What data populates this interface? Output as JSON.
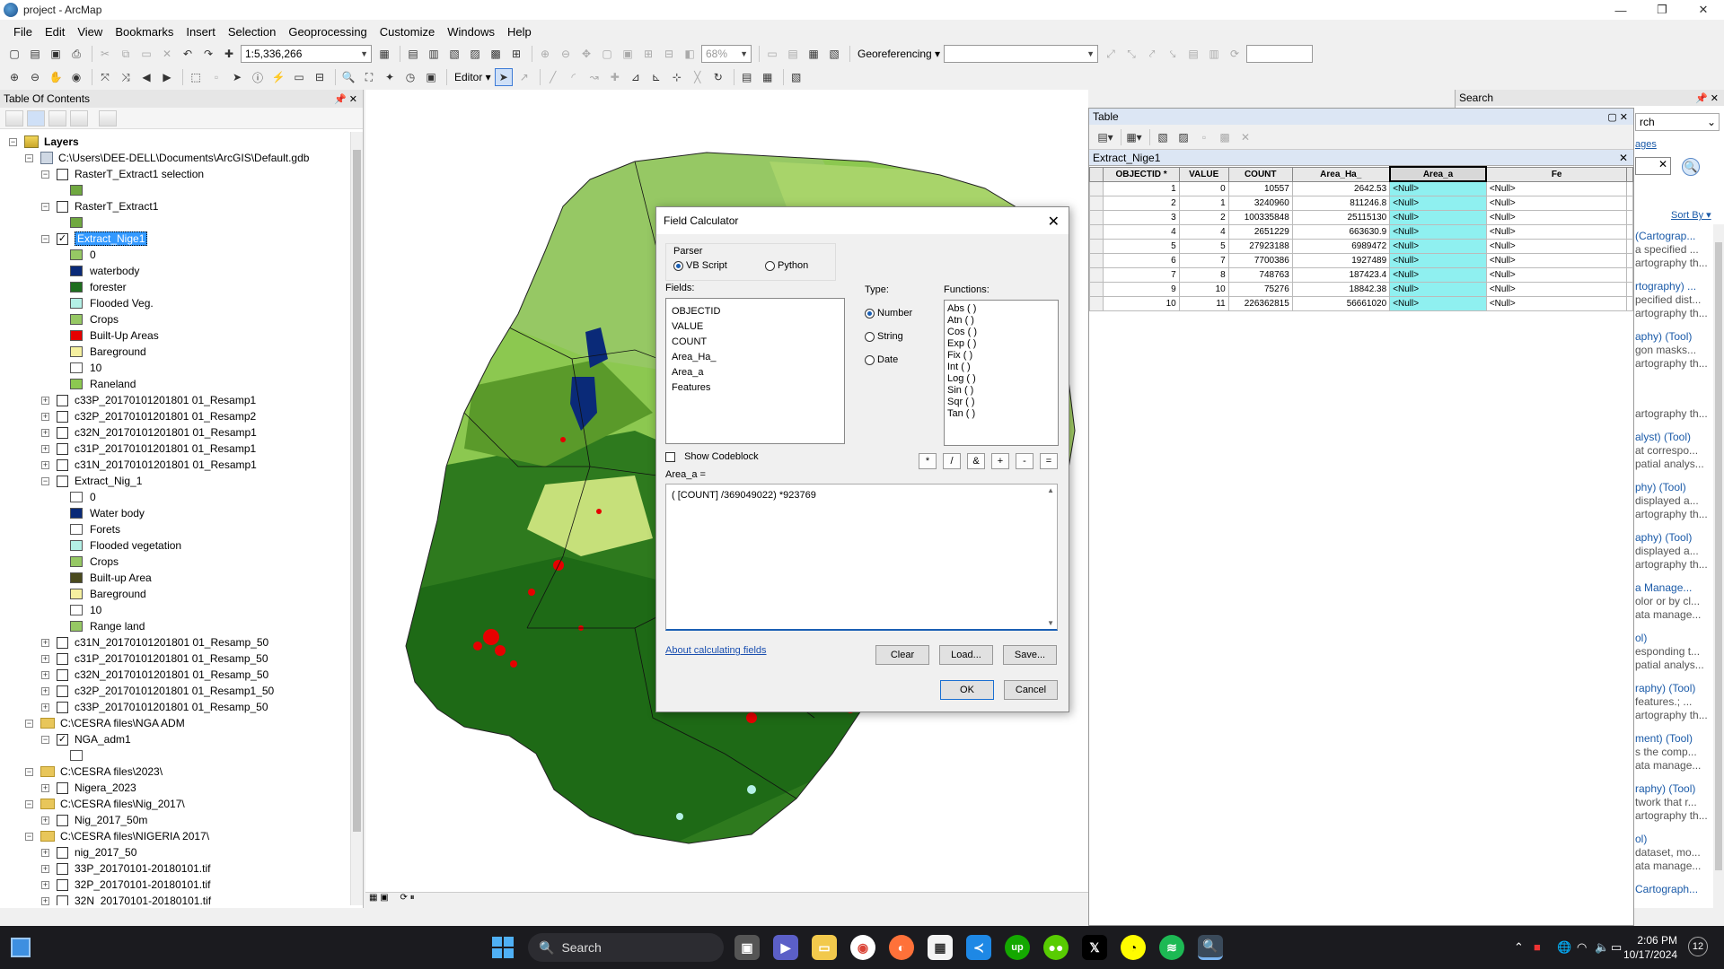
{
  "window": {
    "title": "project - ArcMap",
    "controls": [
      "—",
      "❐",
      "✕"
    ]
  },
  "menu": [
    "File",
    "Edit",
    "View",
    "Bookmarks",
    "Insert",
    "Selection",
    "Geoprocessing",
    "Customize",
    "Windows",
    "Help"
  ],
  "toolbar": {
    "scale": "1:5,336,266",
    "zoom_percent": "68%",
    "georef_label": "Georeferencing ▾",
    "editor_label": "Editor ▾"
  },
  "toc": {
    "title": "Table Of Contents",
    "items": [
      {
        "kind": "root",
        "label": "Layers"
      },
      {
        "kind": "db",
        "label": "C:\\Users\\DEE-DELL\\Documents\\ArcGIS\\Default.gdb"
      },
      {
        "kind": "layer",
        "label": "RasterT_Extract1 selection",
        "checked": false
      },
      {
        "kind": "swatch",
        "label": "",
        "color": "#70a840"
      },
      {
        "kind": "layer",
        "label": "RasterT_Extract1",
        "checked": false
      },
      {
        "kind": "swatch",
        "label": "",
        "color": "#70a840"
      },
      {
        "kind": "layer",
        "label": "Extract_Nige1",
        "checked": true,
        "selected": true
      },
      {
        "kind": "swatch",
        "label": "0",
        "color": "#96c864"
      },
      {
        "kind": "swatch",
        "label": "waterbody",
        "color": "#0a2a78"
      },
      {
        "kind": "swatch",
        "label": "forester",
        "color": "#1e6e1e"
      },
      {
        "kind": "swatch",
        "label": "Flooded Veg.",
        "color": "#b4f0e6"
      },
      {
        "kind": "swatch",
        "label": "Crops",
        "color": "#96c864"
      },
      {
        "kind": "swatch",
        "label": "Built-Up Areas",
        "color": "#e60000"
      },
      {
        "kind": "swatch",
        "label": "Bareground",
        "color": "#f5f0a0"
      },
      {
        "kind": "swatch",
        "label": "10",
        "color": "#ffffff"
      },
      {
        "kind": "swatch",
        "label": "Raneland",
        "color": "#8cc850"
      },
      {
        "kind": "layer",
        "label": "c33P_20170101201801 01_Resamp1",
        "checked": false,
        "collapsed": true
      },
      {
        "kind": "layer",
        "label": "c32P_20170101201801 01_Resamp2",
        "checked": false,
        "collapsed": true
      },
      {
        "kind": "layer",
        "label": "c32N_20170101201801 01_Resamp1",
        "checked": false,
        "collapsed": true
      },
      {
        "kind": "layer",
        "label": "c31P_20170101201801 01_Resamp1",
        "checked": false,
        "collapsed": true
      },
      {
        "kind": "layer",
        "label": "c31N_20170101201801 01_Resamp1",
        "checked": false,
        "collapsed": true
      },
      {
        "kind": "layer",
        "label": "Extract_Nig_1",
        "checked": false
      },
      {
        "kind": "swatch",
        "label": "0",
        "color": "#ffffff"
      },
      {
        "kind": "swatch",
        "label": "Water body",
        "color": "#0a2a78"
      },
      {
        "kind": "swatch",
        "label": "Forets",
        "color": "#ffffff"
      },
      {
        "kind": "swatch",
        "label": "Flooded vegetation",
        "color": "#b4f0e6"
      },
      {
        "kind": "swatch",
        "label": "Crops",
        "color": "#96c864"
      },
      {
        "kind": "swatch",
        "label": "Built-up Area",
        "color": "#4a4a1e"
      },
      {
        "kind": "swatch",
        "label": "Bareground",
        "color": "#f5f0a0"
      },
      {
        "kind": "swatch",
        "label": "10",
        "color": "#ffffff"
      },
      {
        "kind": "swatch",
        "label": "Range land",
        "color": "#96c864"
      },
      {
        "kind": "layer",
        "label": "c31N_20170101201801 01_Resamp_50",
        "checked": false,
        "collapsed": true
      },
      {
        "kind": "layer",
        "label": "c31P_20170101201801 01_Resamp_50",
        "checked": false,
        "collapsed": true
      },
      {
        "kind": "layer",
        "label": "c32N_20170101201801 01_Resamp_50",
        "checked": false,
        "collapsed": true
      },
      {
        "kind": "layer",
        "label": "c32P_20170101201801 01_Resamp1_50",
        "checked": false,
        "collapsed": true
      },
      {
        "kind": "layer",
        "label": "c33P_20170101201801 01_Resamp_50",
        "checked": false,
        "collapsed": true
      },
      {
        "kind": "folder",
        "label": "C:\\CESRA files\\NGA ADM"
      },
      {
        "kind": "layer",
        "label": "NGA_adm1",
        "checked": true
      },
      {
        "kind": "swatch",
        "label": "",
        "color": "#ffffff"
      },
      {
        "kind": "folder",
        "label": "C:\\CESRA files\\2023\\"
      },
      {
        "kind": "layer",
        "label": "Nigera_2023",
        "checked": false,
        "collapsed": true
      },
      {
        "kind": "folder",
        "label": "C:\\CESRA files\\Nig_2017\\"
      },
      {
        "kind": "layer",
        "label": "Nig_2017_50m",
        "checked": false,
        "collapsed": true
      },
      {
        "kind": "folder",
        "label": "C:\\CESRA files\\NIGERIA 2017\\"
      },
      {
        "kind": "layer",
        "label": "nig_2017_50",
        "checked": false,
        "collapsed": true
      },
      {
        "kind": "layer",
        "label": "33P_20170101-20180101.tif",
        "checked": false,
        "collapsed": true
      },
      {
        "kind": "layer",
        "label": "32P_20170101-20180101.tif",
        "checked": false,
        "collapsed": true
      },
      {
        "kind": "layer",
        "label": "32N_20170101-20180101.tif",
        "checked": false,
        "collapsed": true
      }
    ]
  },
  "field_calculator": {
    "title": "Field Calculator",
    "parser_label": "Parser",
    "parser_vb": "VB Script",
    "parser_python": "Python",
    "fields_label": "Fields:",
    "fields": [
      "OBJECTID",
      "VALUE",
      "COUNT",
      "Area_Ha_",
      "Area_a",
      "Features"
    ],
    "type_label": "Type:",
    "types": [
      "Number",
      "String",
      "Date"
    ],
    "functions_label": "Functions:",
    "functions": [
      "Abs ( )",
      "Atn ( )",
      "Cos ( )",
      "Exp ( )",
      "Fix ( )",
      "Int ( )",
      "Log ( )",
      "Sin ( )",
      "Sqr ( )",
      "Tan ( )"
    ],
    "show_codeblock": "Show Codeblock",
    "operators": [
      "*",
      "/",
      "&",
      "+",
      "-",
      "="
    ],
    "target_label": "Area_a =",
    "expression": "( [COUNT] /369049022) *923769",
    "help_link": "About calculating fields",
    "clear": "Clear",
    "load": "Load...",
    "save": "Save...",
    "ok": "OK",
    "cancel": "Cancel"
  },
  "table": {
    "window_title": "Table",
    "tab_title": "Extract_Nige1",
    "columns": [
      "OBJECTID *",
      "VALUE",
      "COUNT",
      "Area_Ha_",
      "Area_a",
      "Fe"
    ],
    "rows": [
      [
        "1",
        "0",
        "10557",
        "2642.53",
        "<Null>",
        "<Null>"
      ],
      [
        "2",
        "1",
        "3240960",
        "811246.8",
        "<Null>",
        "<Null>"
      ],
      [
        "3",
        "2",
        "100335848",
        "25115130",
        "<Null>",
        "<Null>"
      ],
      [
        "4",
        "4",
        "2651229",
        "663630.9",
        "<Null>",
        "<Null>"
      ],
      [
        "5",
        "5",
        "27923188",
        "6989472",
        "<Null>",
        "<Null>"
      ],
      [
        "6",
        "7",
        "7700386",
        "1927489",
        "<Null>",
        "<Null>"
      ],
      [
        "7",
        "8",
        "748763",
        "187423.4",
        "<Null>",
        "<Null>"
      ],
      [
        "9",
        "10",
        "75276",
        "18842.38",
        "<Null>",
        "<Null>"
      ],
      [
        "10",
        "11",
        "226362815",
        "56661020",
        "<Null>",
        "<Null>"
      ]
    ]
  },
  "search": {
    "title": "Search",
    "query_fragment": "rch",
    "link_fragment": "ages",
    "sort": "Sort By ▾",
    "results": [
      {
        "t": "(Cartograp...",
        "d1": "a specified ...",
        "d2": "artography th..."
      },
      {
        "t": "rtography) ...",
        "d1": "pecified dist...",
        "d2": "artography th..."
      },
      {
        "t": "aphy) (Tool)",
        "d1": "gon masks...",
        "d2": "artography th..."
      },
      {
        "t": "",
        "d1": "",
        "d2": "artography th..."
      },
      {
        "t": "alyst) (Tool)",
        "d1": "at correspo...",
        "d2": "patial analys..."
      },
      {
        "t": "phy) (Tool)",
        "d1": "displayed a...",
        "d2": "artography th..."
      },
      {
        "t": "aphy) (Tool)",
        "d1": "displayed a...",
        "d2": "artography th..."
      },
      {
        "t": "a Manage...",
        "d1": "olor or by cl...",
        "d2": "ata manage..."
      },
      {
        "t": "ol)",
        "d1": "esponding t...",
        "d2": "patial analys..."
      },
      {
        "t": "raphy) (Tool)",
        "d1": "features.; ...",
        "d2": "artography th..."
      },
      {
        "t": "ment) (Tool)",
        "d1": "s the comp...",
        "d2": "ata manage..."
      },
      {
        "t": "raphy) (Tool)",
        "d1": "twork that r...",
        "d2": "artography th..."
      },
      {
        "t": "ol)",
        "d1": "dataset, mo...",
        "d2": "ata manage..."
      },
      {
        "t": "Cartograph...",
        "d1": "",
        "d2": ""
      }
    ]
  },
  "taskbar": {
    "search_placeholder": "Search",
    "time": "2:06 PM",
    "date": "10/17/2024",
    "notifications": "12"
  }
}
